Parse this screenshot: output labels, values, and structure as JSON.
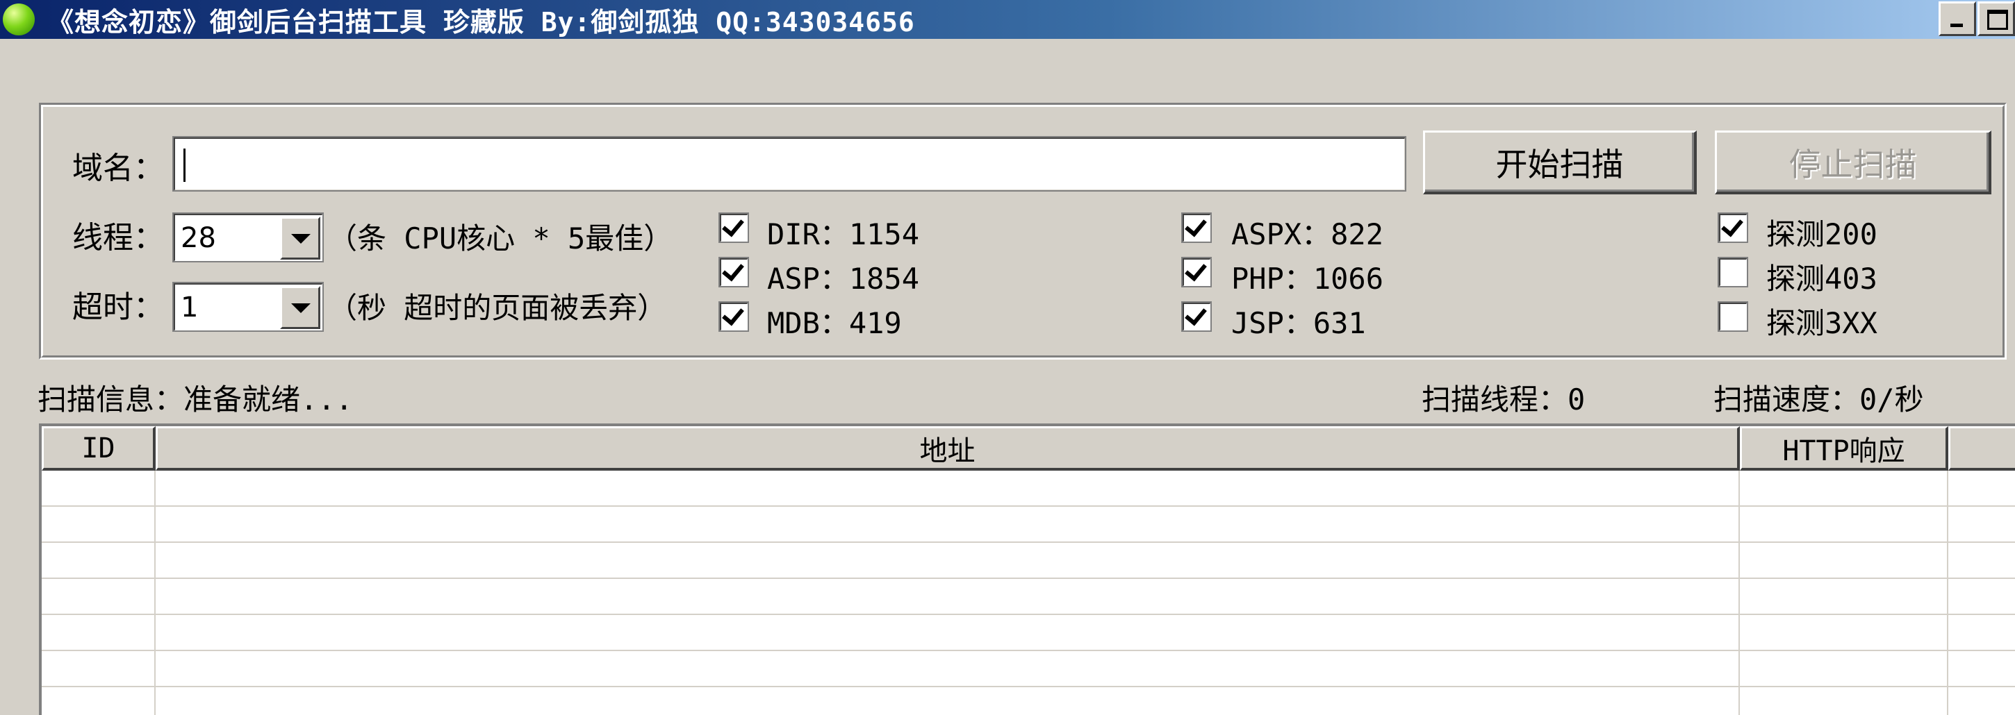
{
  "window": {
    "title": "《想念初恋》御剑后台扫描工具 珍藏版 By:御剑孤独 QQ:343034656"
  },
  "form": {
    "domain_label": "域名：",
    "domain_value": "",
    "threads_label": "线程：",
    "threads_value": "28",
    "threads_hint": "（条 CPU核心 * 5最佳）",
    "timeout_label": "超时：",
    "timeout_value": "1",
    "timeout_hint": "（秒 超时的页面被丢弃）",
    "start_button": "开始扫描",
    "stop_button": "停止扫描"
  },
  "dictionaries": [
    {
      "label": "DIR：1154",
      "checked": true
    },
    {
      "label": "ASP：1854",
      "checked": true
    },
    {
      "label": "MDB：419",
      "checked": true
    },
    {
      "label": "ASPX：822",
      "checked": true
    },
    {
      "label": "PHP：1066",
      "checked": true
    },
    {
      "label": "JSP：631",
      "checked": true
    }
  ],
  "detect": [
    {
      "label": "探测200",
      "checked": true
    },
    {
      "label": "探测403",
      "checked": false
    },
    {
      "label": "探测3XX",
      "checked": false
    }
  ],
  "status": {
    "info": "扫描信息：准备就绪...",
    "threads": "扫描线程：0",
    "speed": "扫描速度：0/秒"
  },
  "table": {
    "columns": [
      "ID",
      "地址",
      "HTTP响应"
    ],
    "rows": []
  }
}
